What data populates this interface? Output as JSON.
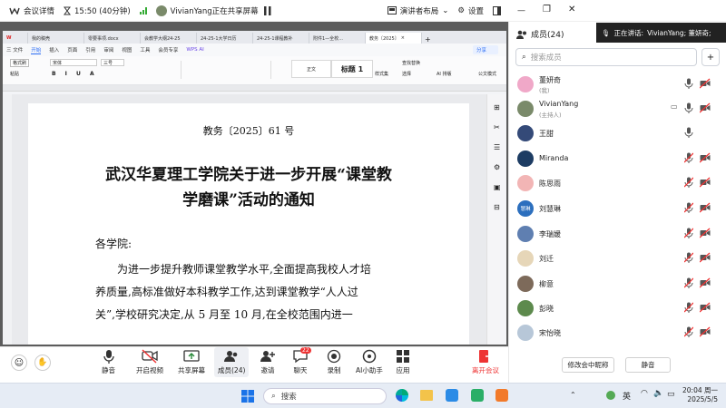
{
  "topbar": {
    "meeting_info": "会议详情",
    "time": "15:50 (40分钟)",
    "sharing_notice": "VivianYang正在共享屏幕",
    "layout_label": "演讲者布局",
    "settings_label": "设置",
    "speaking_label": "正在讲话:",
    "speaking_names": "VivianYang; 董妍奇;"
  },
  "wps": {
    "tabs": [
      "我的稿壳",
      "零要事项.docx",
      "会教学大纲24-25",
      "24-25-1大学日历",
      "24-25-1课程教补",
      "附件1—全校...",
      "教务〔2025〕"
    ],
    "menu": [
      "三 文件",
      "开始",
      "插入",
      "页面",
      "引用",
      "审阅",
      "视图",
      "工具",
      "会员专享",
      "WPS AI"
    ],
    "share_btn": "分享",
    "ribbon": {
      "format_painter": "格式刷",
      "paste": "粘贴",
      "font": "宋体",
      "size": "三号",
      "style_normal": "正文",
      "style_h1": "标题 1",
      "styles_set": "样式集",
      "find_replace": "查找替换",
      "select": "选择",
      "ai_layout": "AI 排版",
      "official": "公文模式"
    }
  },
  "document": {
    "doc_number": "教务〔2025〕61 号",
    "title_line1": "武汉华夏理工学院关于进一步开展“课堂教",
    "title_line2": "学磨课”活动的通知",
    "salutation": "各学院:",
    "para_line1": "为进一步提升教师课堂教学水平,全面提高我校人才培",
    "para_line2": "养质量,高标准做好本科教学工作,达到课堂教学“人人过",
    "para_line3": "关”,学校研究决定,从 5 月至 10 月,在全校范围内进一",
    "annotate_label": "批注"
  },
  "toolbar": {
    "mute": "静音",
    "video": "开启视频",
    "share": "共享屏幕",
    "members": "成员(24)",
    "invite": "邀请",
    "chat": "聊天",
    "chat_badge": "22",
    "record": "录制",
    "ai": "AI小助手",
    "apps": "应用",
    "leave": "离开会议"
  },
  "panel": {
    "title": "成员(24)",
    "search_placeholder": "搜索成员",
    "members": [
      {
        "name": "董妍奇",
        "sub": "(我)",
        "color": "#f0a8c8"
      },
      {
        "name": "VivianYang",
        "sub": "(主持人)",
        "color": "#7a8a6a"
      },
      {
        "name": "王甜",
        "sub": "",
        "color": "#344a78"
      },
      {
        "name": "Miranda",
        "sub": "",
        "color": "#1d3c63"
      },
      {
        "name": "陈思雨",
        "sub": "",
        "color": "#f2b5b5"
      },
      {
        "name": "刘慧琳",
        "sub": "",
        "color": "#2c6fbe",
        "initials": "慧琳"
      },
      {
        "name": "李瑞媛",
        "sub": "",
        "color": "#5f7fb1"
      },
      {
        "name": "刘迁",
        "sub": "",
        "color": "#e6d6b8"
      },
      {
        "name": "柳意",
        "sub": "",
        "color": "#7d6a5a"
      },
      {
        "name": "彭晓",
        "sub": "",
        "color": "#5d8a4d"
      },
      {
        "name": "宋怡晓",
        "sub": "",
        "color": "#b7c7d8"
      }
    ],
    "rename_btn": "修改会中昵称",
    "mute_btn": "静音"
  },
  "taskbar": {
    "search_placeholder": "搜索",
    "ime": "英",
    "time": "20:04 周一",
    "date": "2025/5/5"
  }
}
